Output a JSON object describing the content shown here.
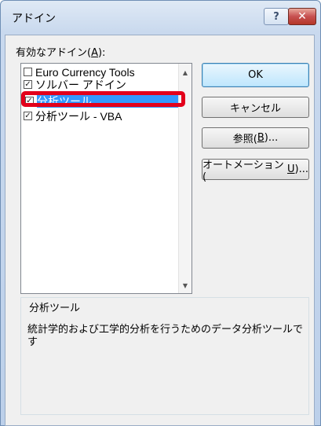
{
  "dialog": {
    "title": "アドイン",
    "help_glyph": "?",
    "close_glyph": "✕"
  },
  "list": {
    "label_prefix": "有効なアドイン(",
    "label_accel": "A",
    "label_suffix": "):",
    "items": [
      {
        "label": "Euro Currency Tools",
        "checked": false
      },
      {
        "label": "ソルバー アドイン",
        "checked": true
      },
      {
        "label": "分析ツール",
        "checked": true,
        "selected": true
      },
      {
        "label": "分析ツール - VBA",
        "checked": true
      }
    ],
    "check_glyph": "✓",
    "scroll_up": "▲",
    "scroll_down": "▼"
  },
  "buttons": {
    "ok": "OK",
    "cancel": "キャンセル",
    "browse_prefix": "参照(",
    "browse_accel": "B",
    "browse_suffix": ")...",
    "automation_prefix": "オートメーション(",
    "automation_accel": "U",
    "automation_suffix": ")..."
  },
  "description": {
    "title": "分析ツール",
    "text": "統計学的および工学的分析を行うためのデータ分析ツールです"
  },
  "colors": {
    "selection": "#3399ff",
    "annotation": "#e3001b"
  }
}
